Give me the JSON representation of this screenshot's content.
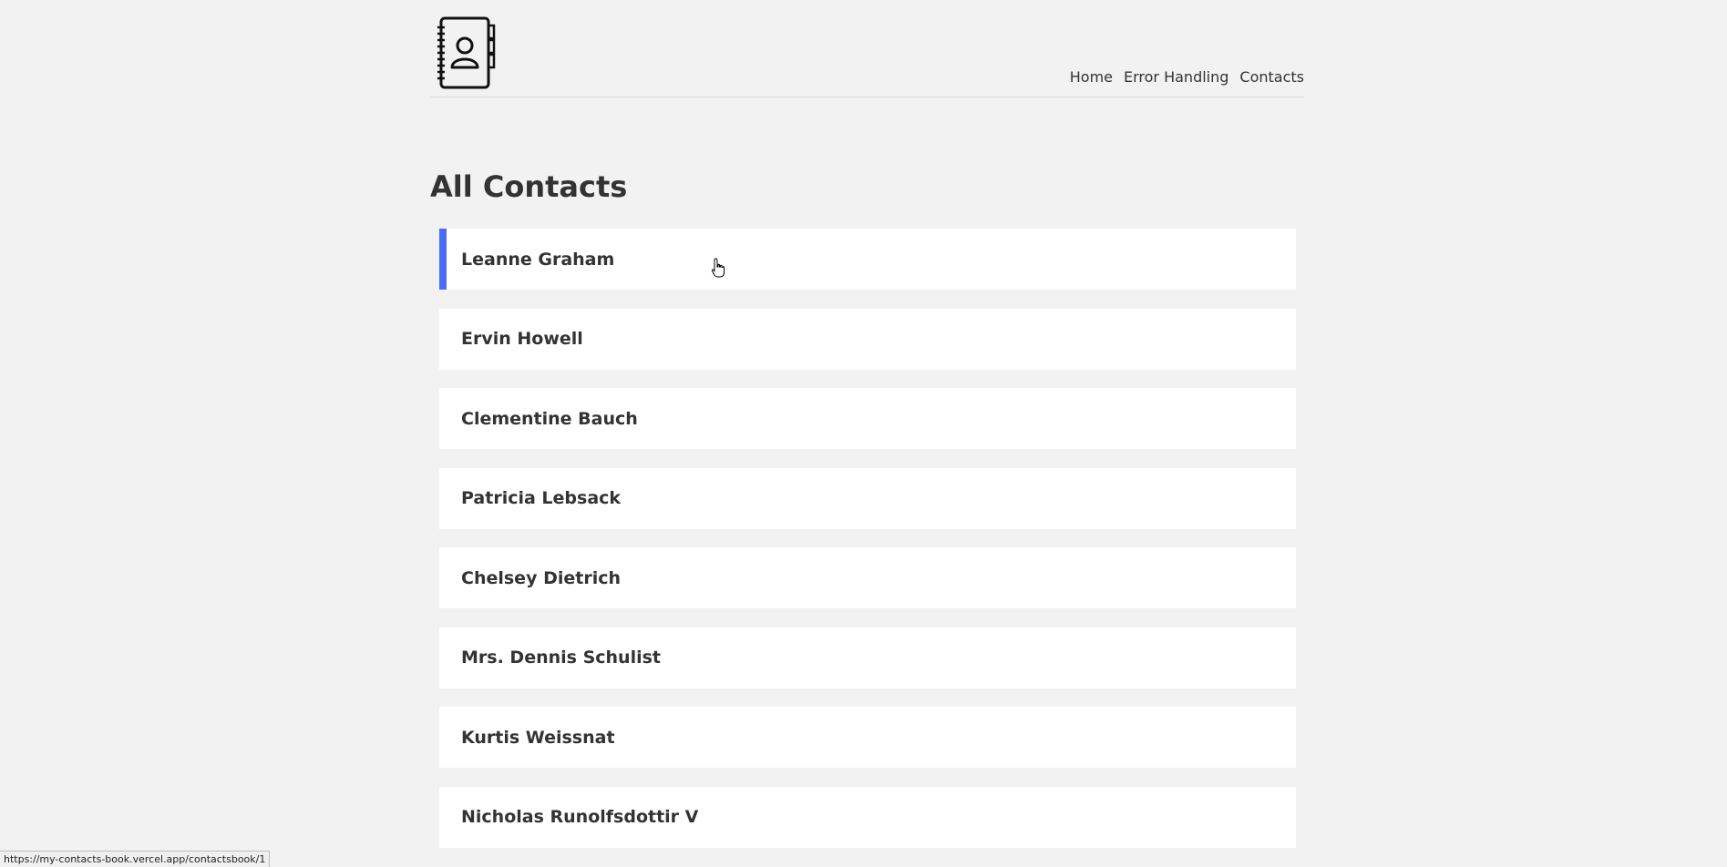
{
  "header": {
    "logo_icon": "contact-book-icon",
    "nav": [
      {
        "label": "Home"
      },
      {
        "label": "Error Handling"
      },
      {
        "label": "Contacts"
      }
    ]
  },
  "main": {
    "title": "All Contacts",
    "contacts": [
      {
        "name": "Leanne Graham",
        "active": true
      },
      {
        "name": "Ervin Howell"
      },
      {
        "name": "Clementine Bauch"
      },
      {
        "name": "Patricia Lebsack"
      },
      {
        "name": "Chelsey Dietrich"
      },
      {
        "name": "Mrs. Dennis Schulist"
      },
      {
        "name": "Kurtis Weissnat"
      },
      {
        "name": "Nicholas Runolfsdottir V"
      }
    ]
  },
  "status_bar": {
    "url": "https://my-contacts-book.vercel.app/contactsbook/1"
  },
  "colors": {
    "background": "#f2f2f2",
    "card": "#ffffff",
    "accent": "#4a6cf7",
    "text": "#333333"
  }
}
